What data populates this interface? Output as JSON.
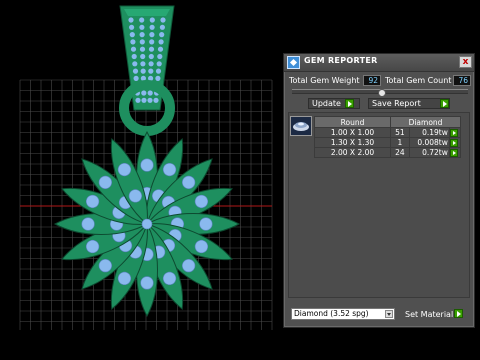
{
  "panel": {
    "title": "GEM REPORTER",
    "close_label": "x",
    "total_weight_label": "Total Gem Weight",
    "total_weight_value": "92",
    "total_count_label": "Total Gem Count",
    "total_count_value": "76",
    "update_label": "Update",
    "save_report_label": "Save Report",
    "columns": [
      "Round",
      "Diamond"
    ],
    "rows": [
      {
        "size": "1.00 X 1.00",
        "count": "51",
        "weight": "0.19tw"
      },
      {
        "size": "1.30 X 1.30",
        "count": "1",
        "weight": "0.008tw"
      },
      {
        "size": "2.00 X 2.00",
        "count": "24",
        "weight": "0.72tw"
      }
    ],
    "material_value": "Diamond   (3.52 spg)",
    "set_material_label": "Set Material"
  },
  "colors": {
    "metal": "#1e8f5f",
    "gem": "#8ab9ee",
    "grid": "#4a4a4a",
    "background": "#000000"
  }
}
